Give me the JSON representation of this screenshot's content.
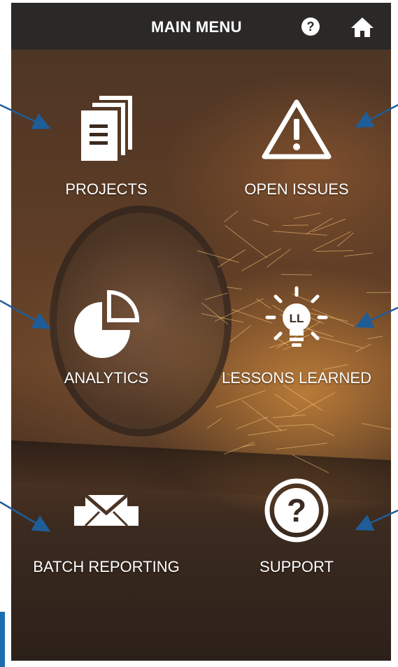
{
  "header": {
    "title": "MAIN MENU",
    "help_icon": "question-circle-icon",
    "home_icon": "home-icon",
    "help_glyph": "?"
  },
  "menu": {
    "projects": {
      "label": "PROJECTS",
      "icon": "documents-icon"
    },
    "open_issues": {
      "label": "OPEN ISSUES",
      "icon": "warning-triangle-icon"
    },
    "analytics": {
      "label": "ANALYTICS",
      "icon": "pie-chart-icon"
    },
    "lessons_learned": {
      "label": "LESSONS LEARNED",
      "icon": "lightbulb-icon",
      "icon_text": "LL"
    },
    "batch_reporting": {
      "label": "BATCH REPORTING",
      "icon": "envelope-icon"
    },
    "support": {
      "label": "SUPPORT",
      "icon": "question-circle-icon",
      "icon_text": "?"
    }
  },
  "colors": {
    "topbar": "#2b2927",
    "pointer_arrow": "#1f5d99",
    "text": "#ffffff"
  }
}
